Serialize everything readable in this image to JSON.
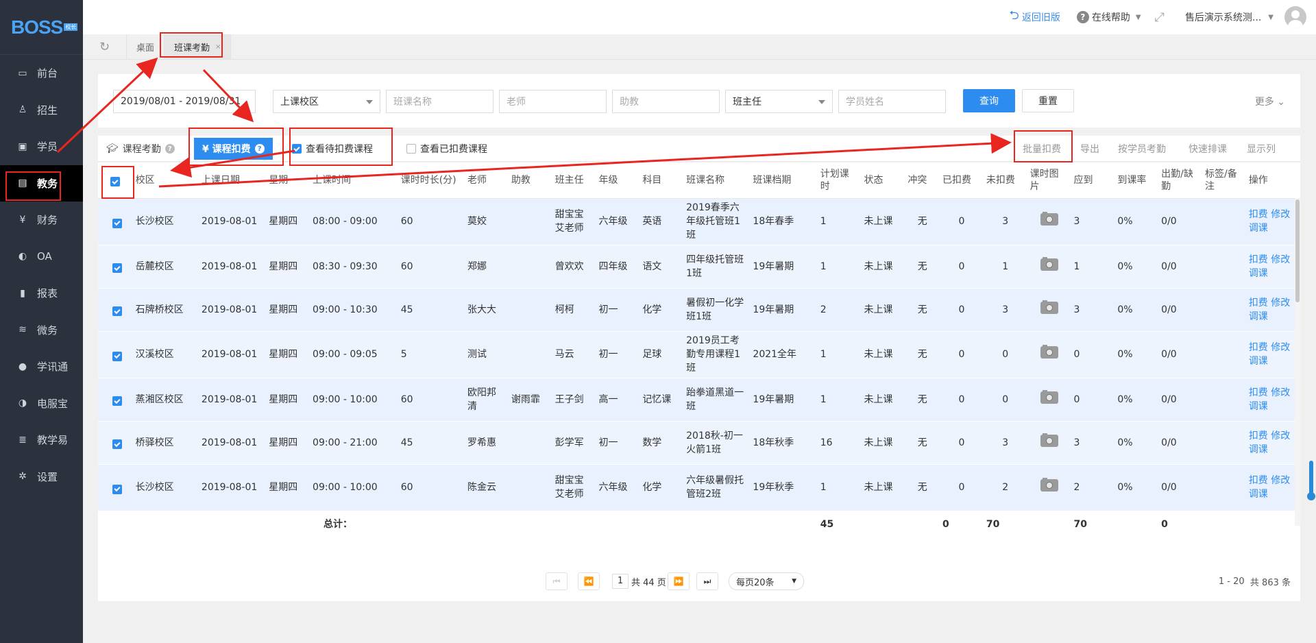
{
  "logo": {
    "text": "BOSS",
    "badge": "校长"
  },
  "sidebar": {
    "items": [
      {
        "label": "前台",
        "icon": "calendar-icon",
        "glyph": "▭"
      },
      {
        "label": "招生",
        "icon": "user-add-icon",
        "glyph": "♙"
      },
      {
        "label": "学员",
        "icon": "id-card-icon",
        "glyph": "▣"
      },
      {
        "label": "教务",
        "icon": "book-icon",
        "glyph": "▤",
        "active": true
      },
      {
        "label": "财务",
        "icon": "yen-coin-icon",
        "glyph": "¥"
      },
      {
        "label": "OA",
        "icon": "toggle-icon",
        "glyph": "◐"
      },
      {
        "label": "报表",
        "icon": "bar-chart-icon",
        "glyph": "▮"
      },
      {
        "label": "微务",
        "icon": "flame-icon",
        "glyph": "≋"
      },
      {
        "label": "学讯通",
        "icon": "location-pin-icon",
        "glyph": "●"
      },
      {
        "label": "电服宝",
        "icon": "headset-icon",
        "glyph": "◑"
      },
      {
        "label": "教学易",
        "icon": "book-stack-icon",
        "glyph": "≣"
      },
      {
        "label": "设置",
        "icon": "gear-icon",
        "glyph": "✲"
      }
    ]
  },
  "header": {
    "back_label": "返回旧版",
    "help_label": "在线帮助",
    "user_label": "售后演示系统测..."
  },
  "tabs": [
    {
      "label": "桌面"
    },
    {
      "label": "班课考勤",
      "close": "×"
    }
  ],
  "filter": {
    "date_range": "2019/08/01 - 2019/08/31",
    "campus": "上课校区",
    "class_name_ph": "班课名称",
    "teacher_ph": "老师",
    "assistant_ph": "助教",
    "head_teacher": "班主任",
    "student_ph": "学员姓名",
    "query": "查询",
    "reset": "重置",
    "more": "更多"
  },
  "toolbar": {
    "attendance": "课程考勤",
    "deduct": "¥ 课程扣费",
    "pending": "查看待扣费课程",
    "done": "查看已扣费课程",
    "batch": "批量扣费",
    "export": "导出",
    "by_student": "按学员考勤",
    "quick": "快速排课",
    "columns": "显示列"
  },
  "table": {
    "headers": [
      "校区",
      "上课日期",
      "星期",
      "上课时间",
      "课时时长(分)",
      "老师",
      "助教",
      "班主任",
      "年级",
      "科目",
      "班课名称",
      "班课档期",
      "计划课时",
      "状态",
      "冲突",
      "已扣费",
      "未扣费",
      "课时图片",
      "应到",
      "到课率",
      "出勤/缺勤",
      "标签/备注",
      "操作"
    ],
    "action_labels": [
      "扣费",
      "修改",
      "调课"
    ],
    "rows": [
      {
        "campus": "长沙校区",
        "date": "2019-08-01",
        "week": "星期四",
        "time": "08:00 - 09:00",
        "dur": "60",
        "teacher": "莫姣",
        "assistant": "",
        "head": "甜宝宝艾老师",
        "grade": "六年级",
        "subject": "英语",
        "cls": "2019春季六年级托管班1班",
        "term": "18年春季",
        "plan": "1",
        "status": "未上课",
        "conflict": "无",
        "paid": "0",
        "unpaid": "3",
        "expect": "3",
        "rate": "0%",
        "att": "0/0"
      },
      {
        "campus": "岳麓校区",
        "date": "2019-08-01",
        "week": "星期四",
        "time": "08:30 - 09:30",
        "dur": "60",
        "teacher": "郑娜",
        "assistant": "",
        "head": "曾欢欢",
        "grade": "四年级",
        "subject": "语文",
        "cls": "四年级托管班1班",
        "term": "19年暑期",
        "plan": "1",
        "status": "未上课",
        "conflict": "无",
        "paid": "0",
        "unpaid": "1",
        "expect": "1",
        "rate": "0%",
        "att": "0/0"
      },
      {
        "campus": "石牌桥校区",
        "date": "2019-08-01",
        "week": "星期四",
        "time": "09:00 - 10:30",
        "dur": "45",
        "teacher": "张大大",
        "assistant": "",
        "head": "柯柯",
        "grade": "初一",
        "subject": "化学",
        "cls": "暑假初一化学班1班",
        "term": "19年暑期",
        "plan": "2",
        "status": "未上课",
        "conflict": "无",
        "paid": "0",
        "unpaid": "3",
        "expect": "3",
        "rate": "0%",
        "att": "0/0"
      },
      {
        "campus": "汉溪校区",
        "date": "2019-08-01",
        "week": "星期四",
        "time": "09:00 - 09:05",
        "dur": "5",
        "teacher": "测试",
        "assistant": "",
        "head": "马云",
        "grade": "初一",
        "subject": "足球",
        "cls": "2019员工考勤专用课程1班",
        "term": "2021全年",
        "plan": "1",
        "status": "未上课",
        "conflict": "无",
        "paid": "0",
        "unpaid": "0",
        "expect": "0",
        "rate": "0%",
        "att": "0/0"
      },
      {
        "campus": "蒸湘区校区",
        "date": "2019-08-01",
        "week": "星期四",
        "time": "09:00 - 10:00",
        "dur": "60",
        "teacher": "欧阳邦清",
        "assistant": "谢雨霏",
        "head": "王子剑",
        "grade": "高一",
        "subject": "记忆课",
        "cls": "跆拳道黑道一班",
        "term": "19年暑期",
        "plan": "1",
        "status": "未上课",
        "conflict": "无",
        "paid": "0",
        "unpaid": "0",
        "expect": "0",
        "rate": "0%",
        "att": "0/0"
      },
      {
        "campus": "桥驿校区",
        "date": "2019-08-01",
        "week": "星期四",
        "time": "09:00 - 21:00",
        "dur": "45",
        "teacher": "罗希惠",
        "assistant": "",
        "head": "彭学军",
        "grade": "初一",
        "subject": "数学",
        "cls": "2018秋-初一火箭1班",
        "term": "18年秋季",
        "plan": "16",
        "status": "未上课",
        "conflict": "无",
        "paid": "0",
        "unpaid": "3",
        "expect": "3",
        "rate": "0%",
        "att": "0/0"
      },
      {
        "campus": "长沙校区",
        "date": "2019-08-01",
        "week": "星期四",
        "time": "09:00 - 10:00",
        "dur": "60",
        "teacher": "陈金云",
        "assistant": "",
        "head": "甜宝宝艾老师",
        "grade": "六年级",
        "subject": "化学",
        "cls": "六年级暑假托管班2班",
        "term": "19年秋季",
        "plan": "1",
        "status": "未上课",
        "conflict": "无",
        "paid": "0",
        "unpaid": "2",
        "expect": "2",
        "rate": "0%",
        "att": "0/0"
      }
    ],
    "total": {
      "label": "总计：",
      "plan": "45",
      "paid": "0",
      "unpaid": "70",
      "expect": "70",
      "att": "0"
    }
  },
  "pager": {
    "page": "1",
    "pages_label": "共 44 页",
    "page_size": "每页20条",
    "range_label": "1 - 20",
    "count_label": "共 863 条"
  },
  "colors": {
    "accent": "#2d8cf0",
    "sidebar": "#2b323d",
    "annotation": "#e8251f"
  }
}
